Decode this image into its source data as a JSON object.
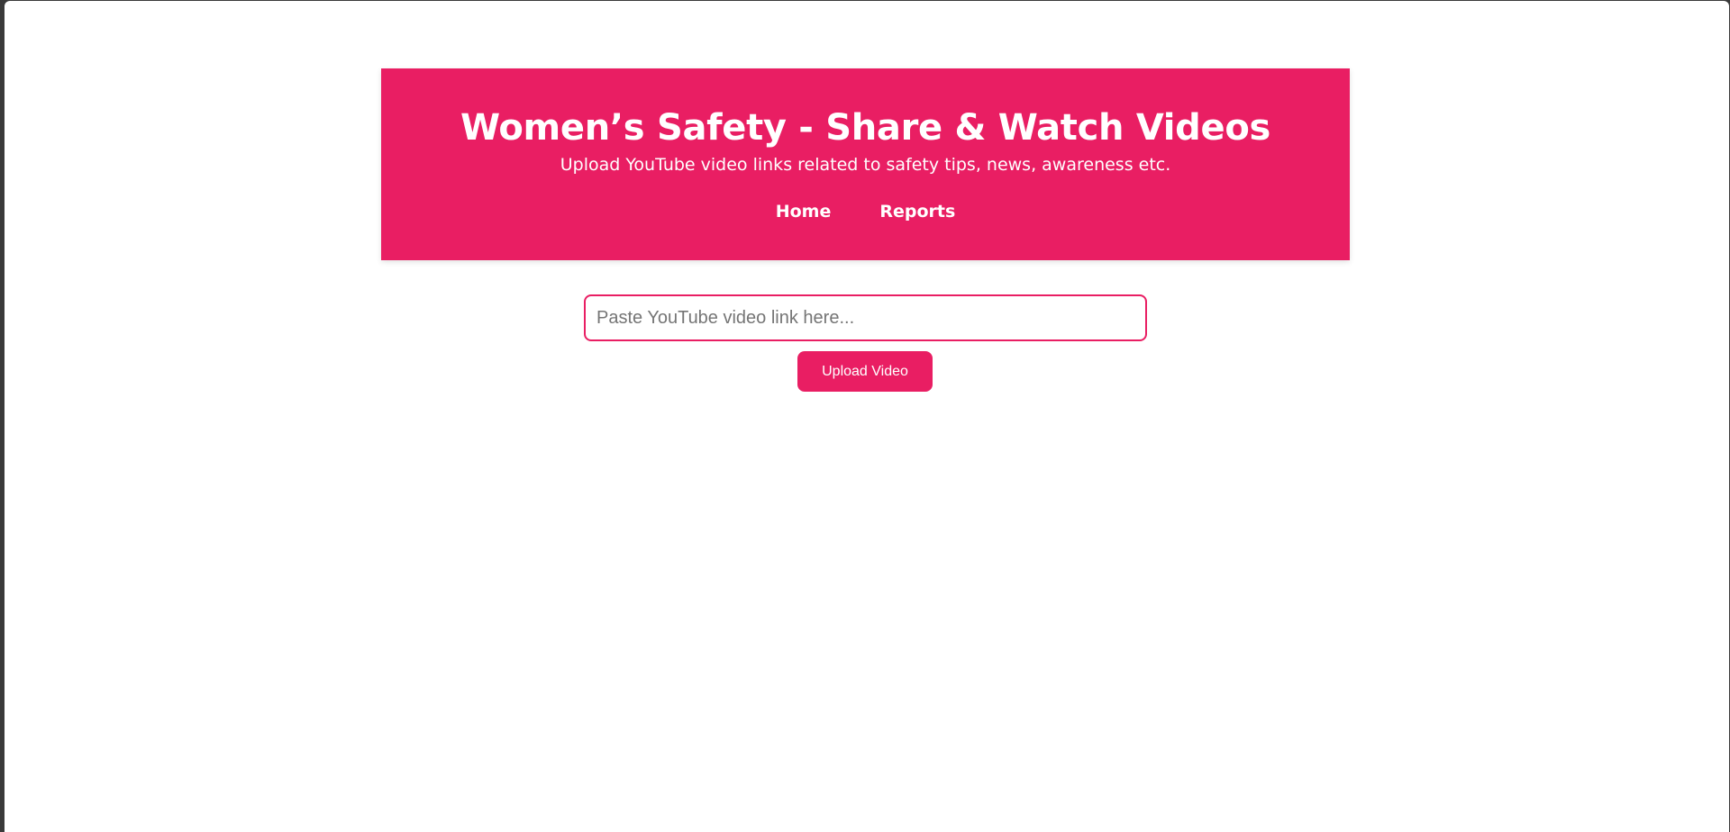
{
  "header": {
    "title": "Women’s Safety - Share & Watch Videos",
    "subtitle": "Upload YouTube video links related to safety tips, news, awareness etc.",
    "nav": [
      {
        "label": "Home"
      },
      {
        "label": "Reports"
      }
    ]
  },
  "upload_form": {
    "input_value": "",
    "input_placeholder": "Paste YouTube video link here...",
    "button_label": "Upload Video"
  },
  "colors": {
    "accent": "#e91e63",
    "background": "#ffffff",
    "text_on_accent": "#ffffff"
  }
}
